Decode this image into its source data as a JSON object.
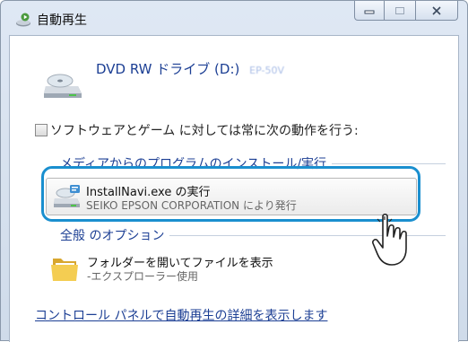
{
  "window": {
    "title": "自動再生",
    "title_icon": "autoplay-icon",
    "caption_buttons": {
      "minimize_icon": "minimize-icon",
      "maximize_icon": "maximize-icon",
      "close_icon": "close-icon",
      "minimize": "▭",
      "maximize": "□",
      "close": "✕"
    }
  },
  "drive": {
    "name": "DVD RW ドライブ (D:)",
    "model": "EP-50V",
    "icon": "dvd-drive-icon"
  },
  "always_do": {
    "label": "ソフトウェアとゲーム に対しては常に次の動作を行う:",
    "checked": false
  },
  "media_section": {
    "title": "メディアからのプログラムのインストール/実行",
    "option": {
      "title": "InstallNavi.exe の実行",
      "subtitle": "SEIKO EPSON CORPORATION により発行",
      "icon": "installer-icon"
    }
  },
  "general_section": {
    "title": "全般 のオプション",
    "option": {
      "title": "フォルダーを開いてファイルを表示",
      "subtitle": "-エクスプローラー使用",
      "icon": "folder-icon"
    }
  },
  "control_panel_link": "コントロール パネルで自動再生の詳細を表示します",
  "colors": {
    "link": "#1c3f94",
    "highlight": "#1a8fcf"
  }
}
